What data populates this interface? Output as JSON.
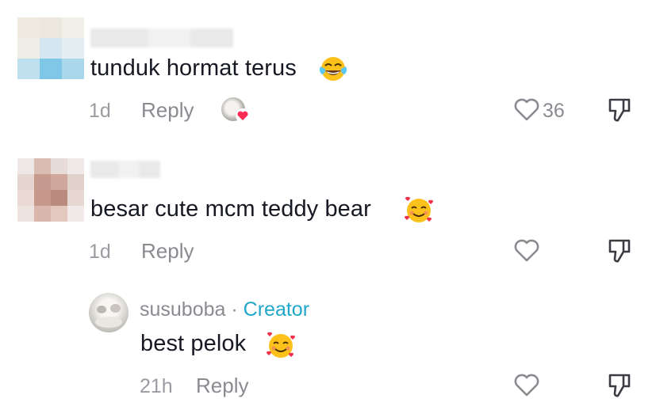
{
  "comments": [
    {
      "text": "tunduk hormat terus",
      "time": "1d",
      "reply_label": "Reply",
      "likes": "36",
      "emoji": "face-with-tears-of-joy"
    },
    {
      "text": "besar cute mcm teddy bear",
      "time": "1d",
      "reply_label": "Reply",
      "emoji": "smiling-face-with-hearts"
    }
  ],
  "reply": {
    "author": "susuboba",
    "separator": "·",
    "badge": "Creator",
    "text": "best pelok",
    "time": "21h",
    "reply_label": "Reply",
    "emoji": "smiling-face-with-hearts"
  },
  "colors": {
    "badge": "#20a7c9",
    "muted": "#8a8b91",
    "heart_badge": "#fe2c55"
  }
}
